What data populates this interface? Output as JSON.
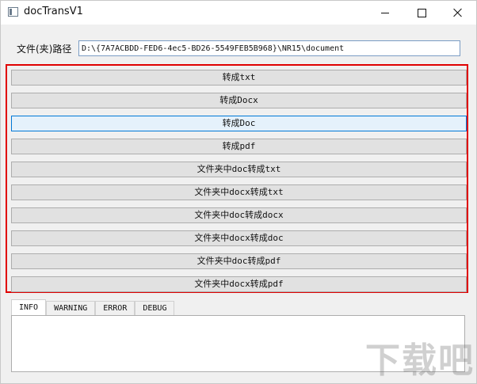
{
  "window": {
    "title": "docTransV1"
  },
  "path": {
    "label": "文件(夹)路径",
    "value": "D:\\{7A7ACBDD-FED6-4ec5-BD26-5549FEB5B968}\\NR15\\document"
  },
  "buttons": [
    {
      "label": "转成txt"
    },
    {
      "label": "转成Docx"
    },
    {
      "label": "转成Doc"
    },
    {
      "label": "转成pdf"
    },
    {
      "label": "文件夹中doc转成txt"
    },
    {
      "label": "文件夹中docx转成txt"
    },
    {
      "label": "文件夹中doc转成docx"
    },
    {
      "label": "文件夹中docx转成doc"
    },
    {
      "label": "文件夹中doc转成pdf"
    },
    {
      "label": "文件夹中docx转成pdf"
    }
  ],
  "tabs": [
    {
      "label": "INFO",
      "active": true
    },
    {
      "label": "WARNING"
    },
    {
      "label": "ERROR"
    },
    {
      "label": "DEBUG"
    }
  ],
  "watermark": {
    "text": "下载吧"
  },
  "colors": {
    "highlight_border": "#e00000",
    "focus_border": "#0078d7"
  }
}
